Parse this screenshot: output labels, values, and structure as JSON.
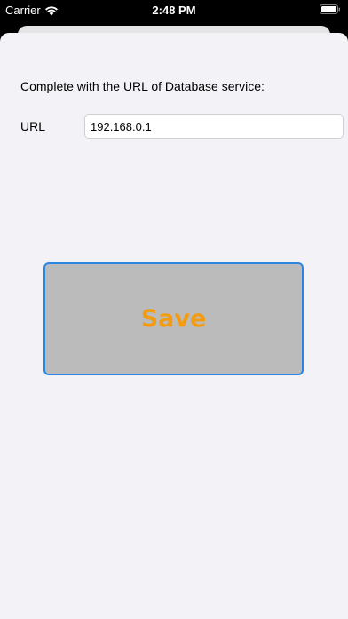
{
  "status_bar": {
    "carrier": "Carrier",
    "time": "2:48 PM"
  },
  "form": {
    "instruction": "Complete with the URL of Database service:",
    "url_label": "URL",
    "url_value": "192.168.0.1",
    "save_label": "Save"
  },
  "colors": {
    "sheet_background": "#f2f2f7",
    "save_button_background": "#bbbbbb",
    "save_button_border": "#2a86e0",
    "save_button_text": "#f39c12"
  },
  "icons": [
    "wifi-icon",
    "battery-icon"
  ]
}
